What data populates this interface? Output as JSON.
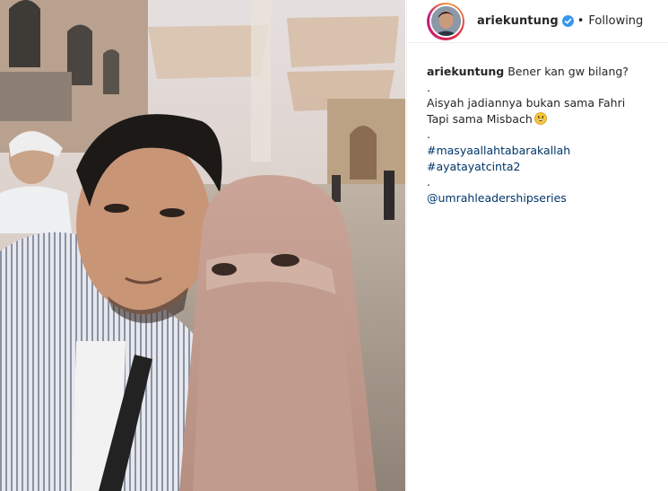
{
  "post": {
    "author": "ariekuntung",
    "follow_status": "Following",
    "separator": "•",
    "photo_description_icon": "photo"
  },
  "caption": {
    "owner": "ariekuntung",
    "first_text": "Bener kan gw bilang?",
    "lines": [
      ".",
      "Aisyah jadiannya bukan sama Fahri",
      "Tapi sama Misbach",
      ".",
      "#masyaallahtabarakallah",
      "#ayatayatcinta2",
      ".",
      "@umrahleadershipseries"
    ],
    "emoji": "grinning-face"
  },
  "colors": {
    "link": "#003569",
    "text": "#262626",
    "verified": "#3897f0"
  }
}
